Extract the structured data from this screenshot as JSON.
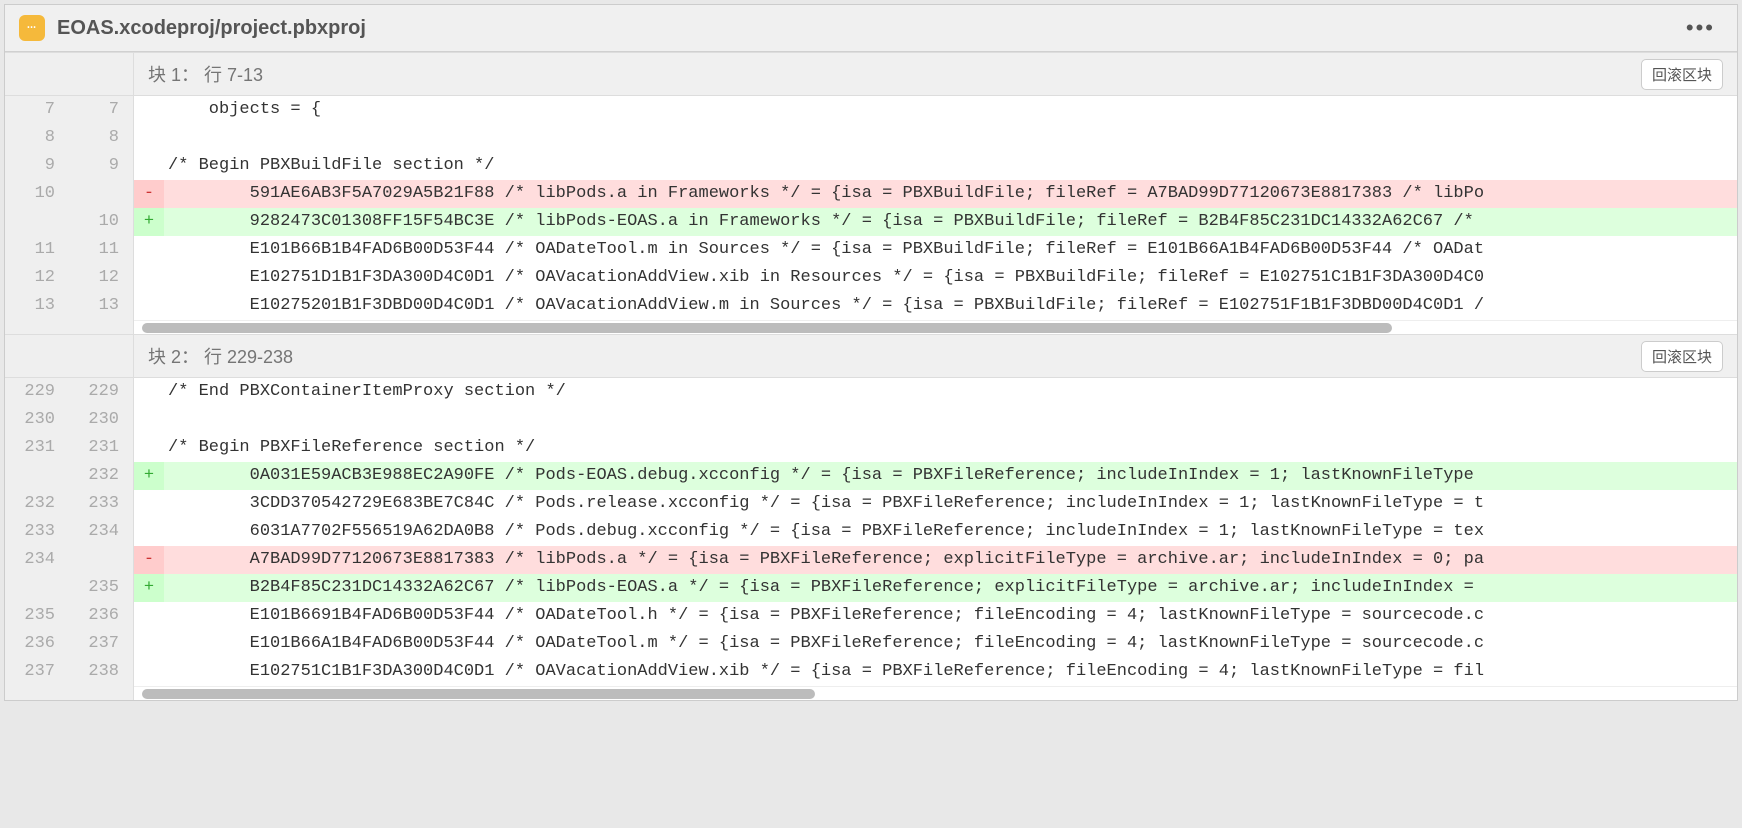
{
  "file": {
    "icon_label": "•••",
    "path": "EOAS.xcodeproj/project.pbxproj",
    "more_label": "•••"
  },
  "buttons": {
    "rollback": "回滚区块"
  },
  "hunks": [
    {
      "title": "块 1： 行 7-13",
      "lines": [
        {
          "old": "7",
          "new": "7",
          "type": "ctx",
          "text": "    objects = {"
        },
        {
          "old": "8",
          "new": "8",
          "type": "ctx",
          "text": ""
        },
        {
          "old": "9",
          "new": "9",
          "type": "ctx",
          "text": "/* Begin PBXBuildFile section */"
        },
        {
          "old": "10",
          "new": "",
          "type": "del",
          "text": "        591AE6AB3F5A7029A5B21F88 /* libPods.a in Frameworks */ = {isa = PBXBuildFile; fileRef = A7BAD99D77120673E8817383 /* libPo"
        },
        {
          "old": "",
          "new": "10",
          "type": "add",
          "text": "        9282473C01308FF15F54BC3E /* libPods-EOAS.a in Frameworks */ = {isa = PBXBuildFile; fileRef = B2B4F85C231DC14332A62C67 /*"
        },
        {
          "old": "11",
          "new": "11",
          "type": "ctx",
          "text": "        E101B66B1B4FAD6B00D53F44 /* OADateTool.m in Sources */ = {isa = PBXBuildFile; fileRef = E101B66A1B4FAD6B00D53F44 /* OADat"
        },
        {
          "old": "12",
          "new": "12",
          "type": "ctx",
          "text": "        E102751D1B1F3DA300D4C0D1 /* OAVacationAddView.xib in Resources */ = {isa = PBXBuildFile; fileRef = E102751C1B1F3DA300D4C0"
        },
        {
          "old": "13",
          "new": "13",
          "type": "ctx",
          "text": "        E10275201B1F3DBD00D4C0D1 /* OAVacationAddView.m in Sources */ = {isa = PBXBuildFile; fileRef = E102751F1B1F3DBD00D4C0D1 /"
        }
      ],
      "scroll_thumb": "long"
    },
    {
      "title": "块 2： 行 229-238",
      "lines": [
        {
          "old": "229",
          "new": "229",
          "type": "ctx",
          "text": "/* End PBXContainerItemProxy section */"
        },
        {
          "old": "230",
          "new": "230",
          "type": "ctx",
          "text": ""
        },
        {
          "old": "231",
          "new": "231",
          "type": "ctx",
          "text": "/* Begin PBXFileReference section */"
        },
        {
          "old": "",
          "new": "232",
          "type": "add",
          "text": "        0A031E59ACB3E988EC2A90FE /* Pods-EOAS.debug.xcconfig */ = {isa = PBXFileReference; includeInIndex = 1; lastKnownFileType"
        },
        {
          "old": "232",
          "new": "233",
          "type": "ctx",
          "text": "        3CDD370542729E683BE7C84C /* Pods.release.xcconfig */ = {isa = PBXFileReference; includeInIndex = 1; lastKnownFileType = t"
        },
        {
          "old": "233",
          "new": "234",
          "type": "ctx",
          "text": "        6031A7702F556519A62DA0B8 /* Pods.debug.xcconfig */ = {isa = PBXFileReference; includeInIndex = 1; lastKnownFileType = tex"
        },
        {
          "old": "234",
          "new": "",
          "type": "del",
          "text": "        A7BAD99D77120673E8817383 /* libPods.a */ = {isa = PBXFileReference; explicitFileType = archive.ar; includeInIndex = 0; pa"
        },
        {
          "old": "",
          "new": "235",
          "type": "add",
          "text": "        B2B4F85C231DC14332A62C67 /* libPods-EOAS.a */ = {isa = PBXFileReference; explicitFileType = archive.ar; includeInIndex ="
        },
        {
          "old": "235",
          "new": "236",
          "type": "ctx",
          "text": "        E101B6691B4FAD6B00D53F44 /* OADateTool.h */ = {isa = PBXFileReference; fileEncoding = 4; lastKnownFileType = sourcecode.c"
        },
        {
          "old": "236",
          "new": "237",
          "type": "ctx",
          "text": "        E101B66A1B4FAD6B00D53F44 /* OADateTool.m */ = {isa = PBXFileReference; fileEncoding = 4; lastKnownFileType = sourcecode.c"
        },
        {
          "old": "237",
          "new": "238",
          "type": "ctx",
          "text": "        E102751C1B1F3DA300D4C0D1 /* OAVacationAddView.xib */ = {isa = PBXFileReference; fileEncoding = 4; lastKnownFileType = fil"
        }
      ],
      "scroll_thumb": "short"
    }
  ]
}
